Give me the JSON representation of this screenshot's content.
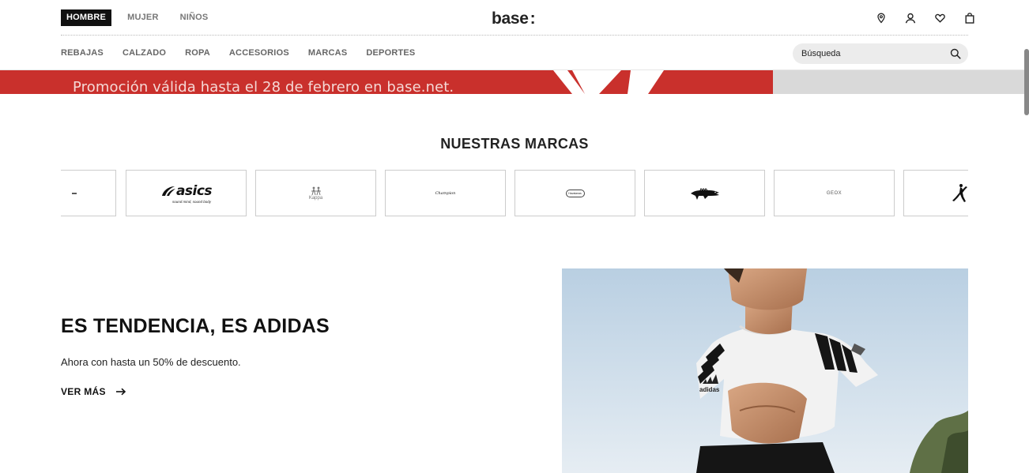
{
  "header": {
    "genders": [
      "HOMBRE",
      "MUJER",
      "NIÑOS"
    ],
    "active_gender": "HOMBRE",
    "logo": "base",
    "categories": [
      "REBAJAS",
      "CALZADO",
      "ROPA",
      "ACCESORIOS",
      "MARCAS",
      "DEPORTES"
    ],
    "search_placeholder": "Búsqueda",
    "icons": [
      "location-pin-icon",
      "user-icon",
      "heart-icon",
      "shopping-bag-icon"
    ]
  },
  "promo": {
    "text": "Promoción válida hasta el 28 de febrero en base.net.",
    "colors": {
      "red": "#c9302c",
      "grey": "#d9d9d9"
    }
  },
  "brands": {
    "title": "NUESTRAS MARCAS",
    "items": [
      "asics",
      "Kappa",
      "Champion",
      "Havaianas",
      "Lacoste",
      "GEOX",
      "Jordan"
    ],
    "asics_tagline": "sound mind, sound body"
  },
  "hero": {
    "title": "ES TENDENCIA, ES ADIDAS",
    "subtitle": "Ahora con hasta un 50% de descuento.",
    "cta": "VER MÁS",
    "image_alt": "adidas"
  }
}
